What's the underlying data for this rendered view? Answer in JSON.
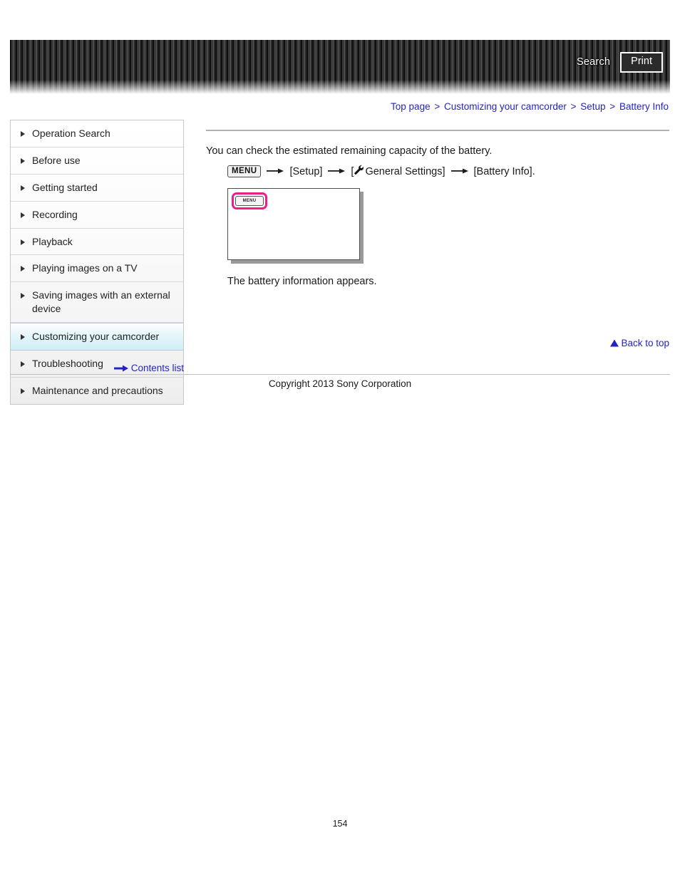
{
  "header": {
    "search_label": "Search",
    "print_label": "Print"
  },
  "breadcrumb": {
    "separator": ">",
    "items": [
      {
        "label": "Top page"
      },
      {
        "label": "Customizing your camcorder"
      },
      {
        "label": "Setup"
      },
      {
        "label": "Battery Info"
      }
    ]
  },
  "sidebar": {
    "items": [
      {
        "label": "Operation Search",
        "active": false
      },
      {
        "label": "Before use",
        "active": false
      },
      {
        "label": "Getting started",
        "active": false
      },
      {
        "label": "Recording",
        "active": false
      },
      {
        "label": "Playback",
        "active": false
      },
      {
        "label": "Playing images on a TV",
        "active": false
      },
      {
        "label": "Saving images with an external device",
        "active": false
      },
      {
        "label": "Customizing your camcorder",
        "active": true
      },
      {
        "label": "Troubleshooting",
        "active": false
      },
      {
        "label": "Maintenance and precautions",
        "active": false
      }
    ],
    "contents_list_label": "Contents list"
  },
  "main": {
    "intro": "You can check the estimated remaining capacity of the battery.",
    "menu_path": {
      "menu_chip": "MENU",
      "step1": "[Setup]",
      "step2_prefix": "[",
      "step2": "General Settings]",
      "step3": "[Battery Info]."
    },
    "illustration": {
      "lcd_menu_label": "MENU",
      "highlight_color": "#ec1e8c"
    },
    "result": "The battery information appears.",
    "back_to_top_label": "Back to top"
  },
  "footer": {
    "copyright": "Copyright 2013 Sony Corporation",
    "page_number": "154"
  },
  "colors": {
    "link": "#2323c8",
    "active_nav": "#cfeef6",
    "highlight": "#ec1e8c"
  }
}
